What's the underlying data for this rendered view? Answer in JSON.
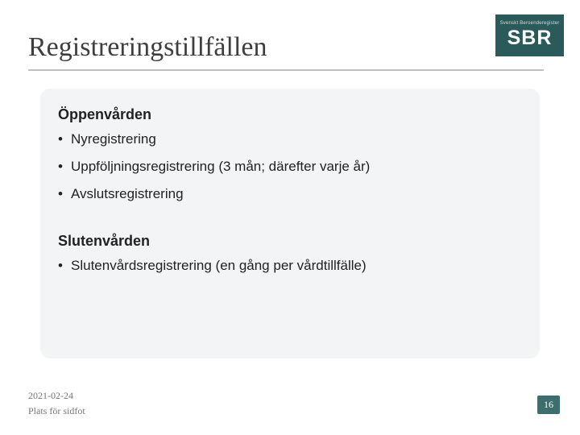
{
  "title": "Registreringstillfällen",
  "logo": {
    "sub": "Svenskt\nBeroenderegister",
    "main": "SBR"
  },
  "sections": [
    {
      "heading": "Öppenvården",
      "items": [
        "Nyregistrering",
        "Uppföljningsregistrering (3 mån; därefter varje år)",
        "Avslutsregistrering"
      ]
    },
    {
      "heading": "Slutenvården",
      "items": [
        "Slutenvårdsregistrering (en gång per vårdtillfälle)"
      ]
    }
  ],
  "footer": {
    "date": "2021-02-24",
    "place": "Plats för sidfot"
  },
  "page_number": "16"
}
